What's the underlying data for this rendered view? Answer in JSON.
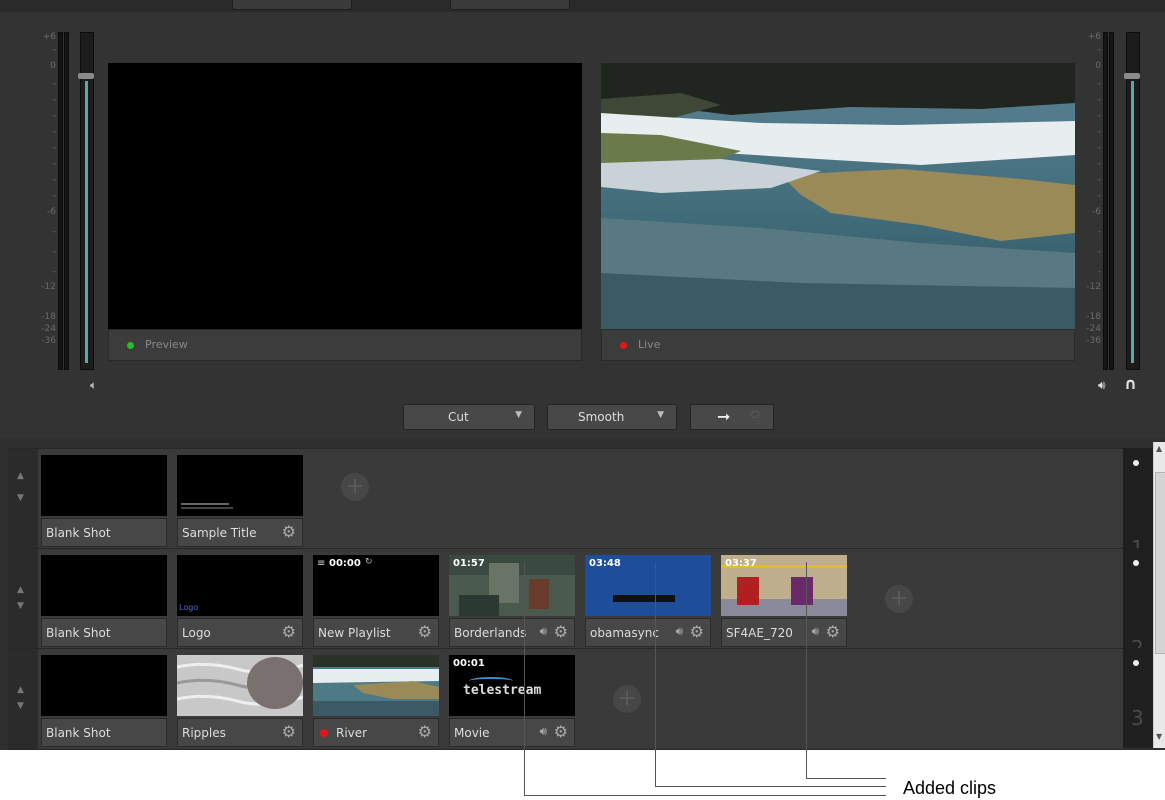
{
  "monitors": {
    "preview_label": "Preview",
    "live_label": "Live",
    "preview_dot_color": "#22c022",
    "live_dot_color": "#e01818"
  },
  "meter_scale_left": [
    "+6",
    "0",
    "-6",
    "-12",
    "-18",
    "-24",
    "-36"
  ],
  "meter_scale_right": [
    "+6",
    "0",
    "-6",
    "-12",
    "-18",
    "-24",
    "-36"
  ],
  "transitions": {
    "cut_label": "Cut",
    "smooth_label": "Smooth"
  },
  "layers": [
    {
      "number": "1",
      "shots": [
        {
          "name": "Blank Shot"
        },
        {
          "name": "Sample Title"
        }
      ]
    },
    {
      "number": "2",
      "shots": [
        {
          "name": "Blank Shot"
        },
        {
          "name": "Logo",
          "thumb_text": "Logo"
        },
        {
          "name": "New Playlist",
          "time": "00:00"
        },
        {
          "name": "Borderlands",
          "time": "01:57"
        },
        {
          "name": "obamasync",
          "time": "03:48"
        },
        {
          "name": "SF4AE_720",
          "time": "03:37"
        }
      ]
    },
    {
      "number": "3",
      "shots": [
        {
          "name": "Blank Shot"
        },
        {
          "name": "Ripples"
        },
        {
          "name": "River"
        },
        {
          "name": "Movie",
          "time": "00:01",
          "thumb_text": "telestream"
        }
      ]
    }
  ],
  "callout": "Added clips"
}
